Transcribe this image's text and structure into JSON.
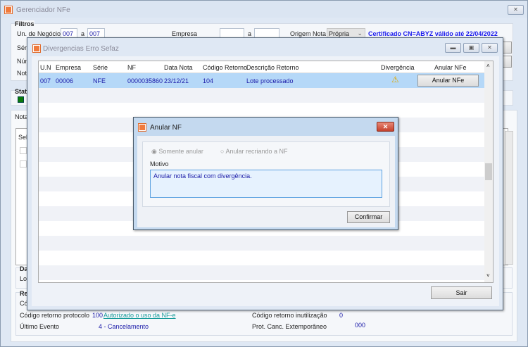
{
  "main_window": {
    "title": "Gerenciador NFe",
    "filtros": {
      "title": "Filtros",
      "un_negocio_label": "Un. de Negócio",
      "un_from": "007",
      "a1": "a",
      "un_to": "007",
      "empresa_label": "Empresa",
      "a2": "a",
      "empresa_from": "",
      "empresa_to": "",
      "origem_label": "Origem Nota",
      "origem_value": "Própria",
      "certificado": "Certificado CN=ABYZ válido até 22/04/2022",
      "serie_label": "Séri",
      "numero_label": "Núm",
      "nota_label": "Nota"
    },
    "status_title": "Stat",
    "tab_label": "Nota",
    "grid_sel_header": "Sel",
    "dados_title": "Da",
    "lote_label": "Lot",
    "retorno_title": "Re",
    "codigo_label": "Có",
    "cod_ret_protocolo_label": "Código retorno protocolo",
    "cod_ret_protocolo_code": "100",
    "cod_ret_protocolo_link": "Autorizado o uso da NF-e",
    "ultimo_evento_label": "Último Evento",
    "ultimo_evento_value": "4 - Cancelamento",
    "cod_ret_inut_label": "Código retorno inutilização",
    "cod_ret_inut_value": "0",
    "prot_canc_label": "Prot. Canc. Extemporâneo",
    "prot_canc_value": "000"
  },
  "divergencias": {
    "title": "Divergencias Erro Sefaz",
    "columns": [
      "U.N",
      "Empresa",
      "Série",
      "NF",
      "Data Nota",
      "Código Retorno",
      "Descrição Retorno",
      "Divergência",
      "Anular NFe"
    ],
    "rows": [
      {
        "un": "007",
        "empresa": "00006",
        "serie": "NFE",
        "nf": "0000035860",
        "data": "23/12/21",
        "codigo": "104",
        "descricao": "Lote processado",
        "divergencia": "warning-icon",
        "action": "Anular NFe"
      }
    ],
    "sair": "Sair"
  },
  "anular": {
    "title": "Anular NF",
    "opt1": "Somente anular",
    "opt2": "Anular recriando a NF",
    "selected": "Somente anular",
    "motivo_label": "Motivo",
    "motivo_value": "Anular nota fiscal com divergência.",
    "confirmar": "Confirmar"
  }
}
